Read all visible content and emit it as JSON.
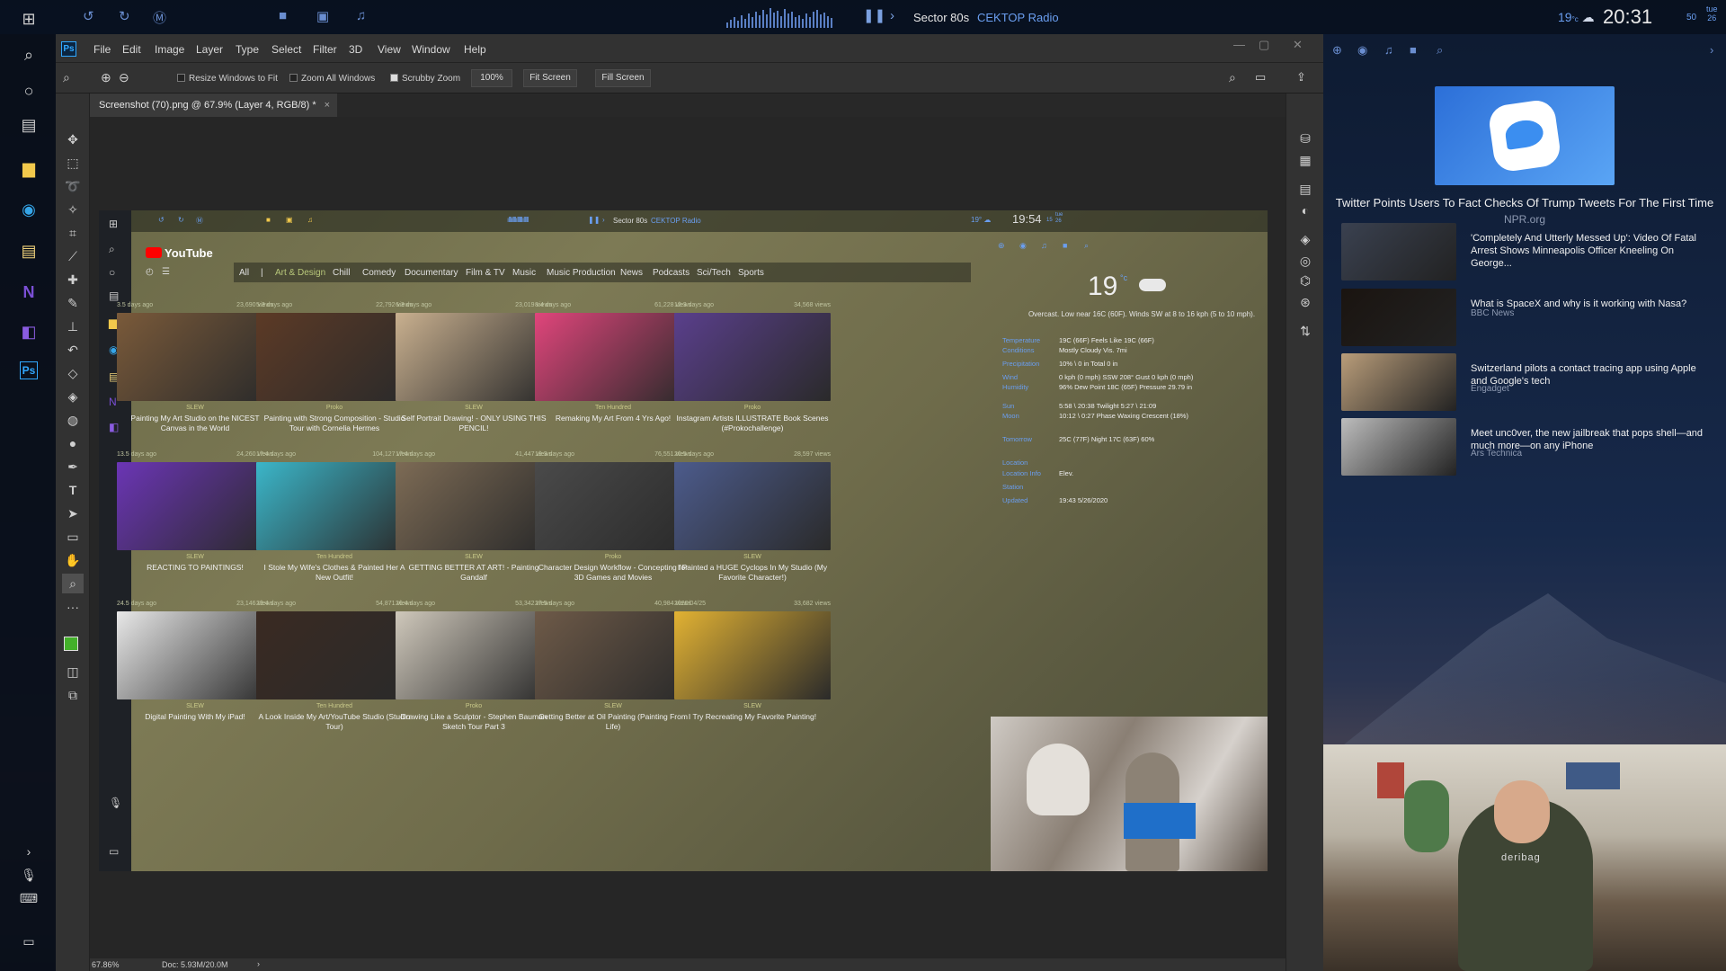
{
  "topbar": {
    "track": "Sector 80s",
    "station": "CEKTOP Radio",
    "temperature": "19",
    "temp_unit": "°c",
    "time": "20:31",
    "seconds": "50",
    "day": "tue",
    "date": "26"
  },
  "photoshop": {
    "logo": "Ps",
    "menu": [
      "File",
      "Edit",
      "Image",
      "Layer",
      "Type",
      "Select",
      "Filter",
      "3D",
      "View",
      "Window",
      "Help"
    ],
    "options": {
      "resize_windows": "Resize Windows to Fit",
      "zoom_all": "Zoom All Windows",
      "scrubby_zoom": "Scrubby Zoom",
      "zoom_value": "100%",
      "fit_screen": "Fit Screen",
      "fill_screen": "Fill Screen"
    },
    "document_tab": "Screenshot (70).png @ 67.9% (Layer 4, RGB/8) *",
    "status_zoom": "67.86%",
    "status_doc": "Doc: 5.93M/20.0M"
  },
  "inner": {
    "topbar": {
      "track": "Sector 80s",
      "station": "CEKTOP Radio",
      "temp": "19",
      "time": "19:54",
      "sec": "15",
      "day": "tue",
      "date": "26"
    },
    "youtube_label": "YouTube",
    "categories": [
      "All",
      "|",
      "Art & Design",
      "Chill",
      "Comedy",
      "Documentary",
      "Film & TV",
      "Music",
      "Music Production",
      "News",
      "Podcasts",
      "Sci/Tech",
      "Sports"
    ],
    "active_category": "Art & Design",
    "videos": [
      {
        "age": "3.5 days ago",
        "views": "23,690 views",
        "channel": "SLEW",
        "title": "Painting My Art Studio on the NICEST Canvas in the World",
        "color": "#7a5a3a"
      },
      {
        "age": "5.3 days ago",
        "views": "22,792 views",
        "channel": "Proko",
        "title": "Painting with Strong Composition - Studio Tour with Cornelia Hermes",
        "color": "#5c3a26"
      },
      {
        "age": "6.3 days ago",
        "views": "23,019 views",
        "channel": "SLEW",
        "title": "Self Portrait Drawing! - ONLY USING THIS PENCIL!",
        "color": "#c9b08f"
      },
      {
        "age": "8.4 days ago",
        "views": "61,228 views",
        "channel": "Ten Hundred",
        "title": "Remaking My Art From 4 Yrs Ago!",
        "color": "#e0457b"
      },
      {
        "age": "12.3 days ago",
        "views": "34,568 views",
        "channel": "Proko",
        "title": "Instagram Artists ILLUSTRATE Book Scenes (#Prokochallenge)",
        "color": "#5a3f8c"
      },
      {
        "age": "13.5 days ago",
        "views": "24,260 views",
        "channel": "SLEW",
        "title": "REACTING TO PAINTINGS!",
        "color": "#6b35b5"
      },
      {
        "age": "17.4 days ago",
        "views": "104,127 views",
        "channel": "Ten Hundred",
        "title": "I Stole My Wife's Clothes & Painted Her A New Outfit!",
        "color": "#3bb6c9"
      },
      {
        "age": "17.4 days ago",
        "views": "41,447 views",
        "channel": "SLEW",
        "title": "GETTING BETTER AT ART! - Painting Gandalf",
        "color": "#7d6b55"
      },
      {
        "age": "19.3 days ago",
        "views": "76,551 views",
        "channel": "Proko",
        "title": "Character Design Workflow - Concepting for 3D Games and Movies",
        "color": "#4a4a4a"
      },
      {
        "age": "20.5 days ago",
        "views": "28,597 views",
        "channel": "SLEW",
        "title": "I Painted a HUGE Cyclops In My Studio (My Favorite Character!)",
        "color": "#4c5b8c"
      },
      {
        "age": "24.5 days ago",
        "views": "23,146 views",
        "channel": "SLEW",
        "title": "Digital Painting With My iPad!",
        "color": "#e8e8e8"
      },
      {
        "age": "23.4 days ago",
        "views": "54,871 views",
        "channel": "Ten Hundred",
        "title": "A Look Inside My Art/YouTube Studio (Studio Tour)",
        "color": "#3a2a22"
      },
      {
        "age": "26.4 days ago",
        "views": "53,342 views",
        "channel": "Proko",
        "title": "Drawing Like a Sculptor - Stephen Bauman Sketch Tour Part 3",
        "color": "#cfc8bb"
      },
      {
        "age": "27.5 days ago",
        "views": "40,984 views",
        "channel": "SLEW",
        "title": "Getting Better at Oil Painting (Painting From Life)",
        "color": "#6e5a48"
      },
      {
        "age": "2020/04/25",
        "views": "33,682 views",
        "channel": "SLEW",
        "title": "I Try Recreating My Favorite Painting!",
        "color": "#e2b233"
      }
    ],
    "weather": {
      "temp": "19",
      "unit": "°c",
      "description": "Overcast. Low near 16C (60F). Winds SW at 8 to 16 kph (5 to 10 mph).",
      "rows": [
        {
          "label": "Temperature",
          "value": "19C (66F)  Feels Like 19C (66F)"
        },
        {
          "label": "Conditions",
          "value": "Mostly Cloudy  Vis. 7mi"
        },
        {
          "label": "Precipitation",
          "value": "10% \\ 0 in  Total 0 in"
        },
        {
          "label": "Wind",
          "value": "0 kph (0 mph) SSW 208°  Gust 0 kph (0 mph)"
        },
        {
          "label": "Humidity",
          "value": "96%  Dew Point 18C (65F)  Pressure 29.79 in"
        },
        {
          "label": "Sun",
          "value": "5:58 \\ 20:38  Twilight 5:27 \\ 21:09"
        },
        {
          "label": "Moon",
          "value": "10:12 \\ 0:27  Phase Waxing Crescent (18%)"
        },
        {
          "label": "Tomorrow",
          "value": "25C (77F)  Night 17C (63F)  60%"
        },
        {
          "label": "Location",
          "value": ""
        },
        {
          "label": "Location Info",
          "value": "Elev."
        },
        {
          "label": "Station",
          "value": ""
        },
        {
          "label": "Updated",
          "value": "19:43 5/26/2020"
        }
      ]
    }
  },
  "rightpanel": {
    "headline": {
      "title": "Twitter Points Users To Fact Checks Of Trump Tweets For The First Time",
      "source": "NPR.org"
    },
    "news": [
      {
        "title": "'Completely And Utterly Messed Up': Video Of Fatal Arrest Shows Minneapolis Officer Kneeling On George...",
        "source": "",
        "color": "#3a4150"
      },
      {
        "title": "What is SpaceX and why is it working with Nasa?",
        "source": "BBC News",
        "color": "#1a1410"
      },
      {
        "title": "Switzerland pilots a contact tracing app using Apple and Google's tech",
        "source": "Engadget",
        "color": "#b99d7a"
      },
      {
        "title": "Meet unc0ver, the new jailbreak that pops shell—and much more—on any iPhone",
        "source": "Ars Technica",
        "color": "#bdbdbd"
      }
    ],
    "webcam_shirt": "deribag"
  }
}
